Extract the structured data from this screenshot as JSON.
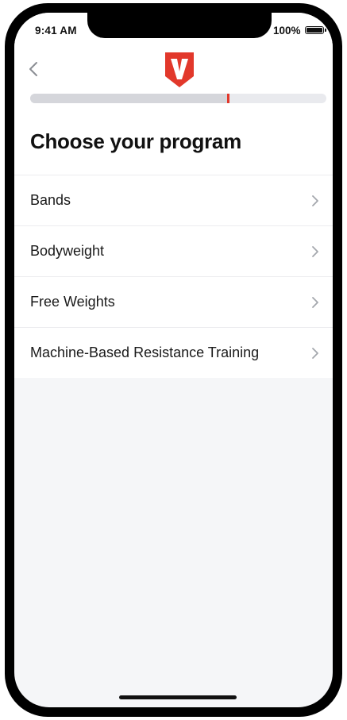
{
  "status_bar": {
    "time": "9:41 AM",
    "battery_percent": "100%"
  },
  "header": {
    "back_icon": "chevron-left-icon",
    "logo_icon": "v-shield-logo",
    "brand_color": "#e2382b"
  },
  "progress": {
    "fraction": 0.67
  },
  "page": {
    "title": "Choose your program"
  },
  "programs": [
    {
      "label": "Bands"
    },
    {
      "label": "Bodyweight"
    },
    {
      "label": "Free Weights"
    },
    {
      "label": "Machine-Based Resistance Training"
    }
  ],
  "colors": {
    "accent": "#e2382b",
    "background": "#f5f6f8",
    "surface": "#ffffff",
    "text": "#111111"
  }
}
